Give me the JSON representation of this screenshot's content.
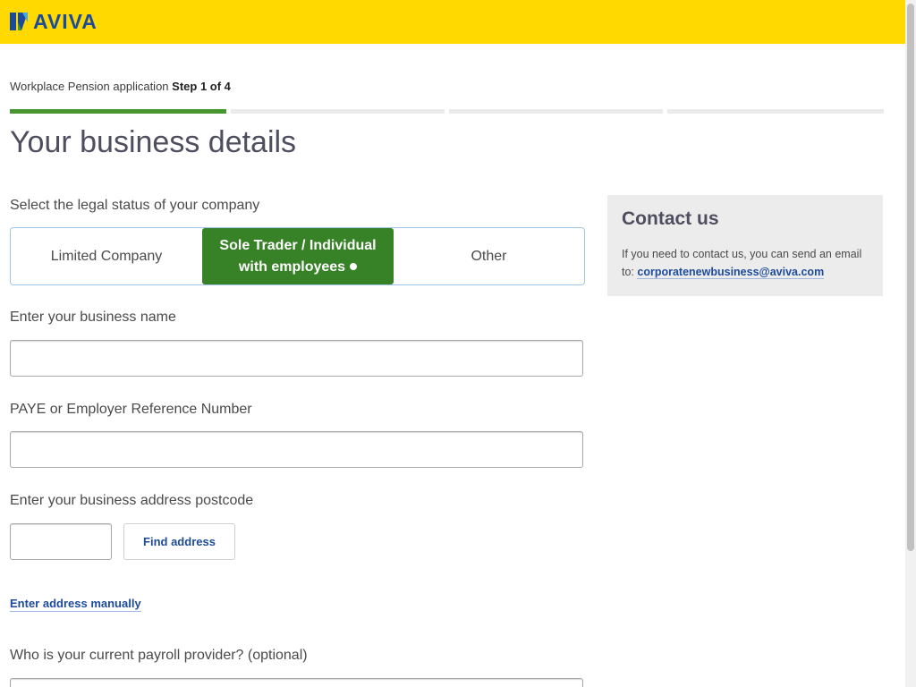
{
  "header": {
    "brand": "AVIVA",
    "logo_icon": "aviva-logo-icon"
  },
  "step": {
    "prefix": "Workplace Pension application",
    "current": "Step 1 of 4",
    "active_step": 1,
    "total_steps": 4
  },
  "page_title": "Your business details",
  "legal_status": {
    "label": "Select the legal status of your company",
    "options": [
      {
        "label": "Limited Company"
      },
      {
        "label": "Sole Trader / Individual",
        "label_line2": "with employees"
      },
      {
        "label": "Other"
      }
    ],
    "selected_index": 1
  },
  "business_name": {
    "label": "Enter your business name",
    "value": "",
    "placeholder": ""
  },
  "paye": {
    "label": "PAYE or Employer Reference Number",
    "value": "",
    "placeholder": ""
  },
  "postcode": {
    "label": "Enter your business address postcode",
    "value": "",
    "find_button": "Find address",
    "manual_link": "Enter address manually"
  },
  "payroll": {
    "label": "Who is your current payroll provider? (optional)"
  },
  "contact": {
    "title": "Contact us",
    "text": "If you need to contact us, you can send an email to:",
    "email": "corporatenewbusiness@aviva.com"
  },
  "colors": {
    "brand_yellow": "#ffd900",
    "brand_blue": "#1d4b9b",
    "accent_green": "#378126",
    "progress_green": "#48962f"
  }
}
